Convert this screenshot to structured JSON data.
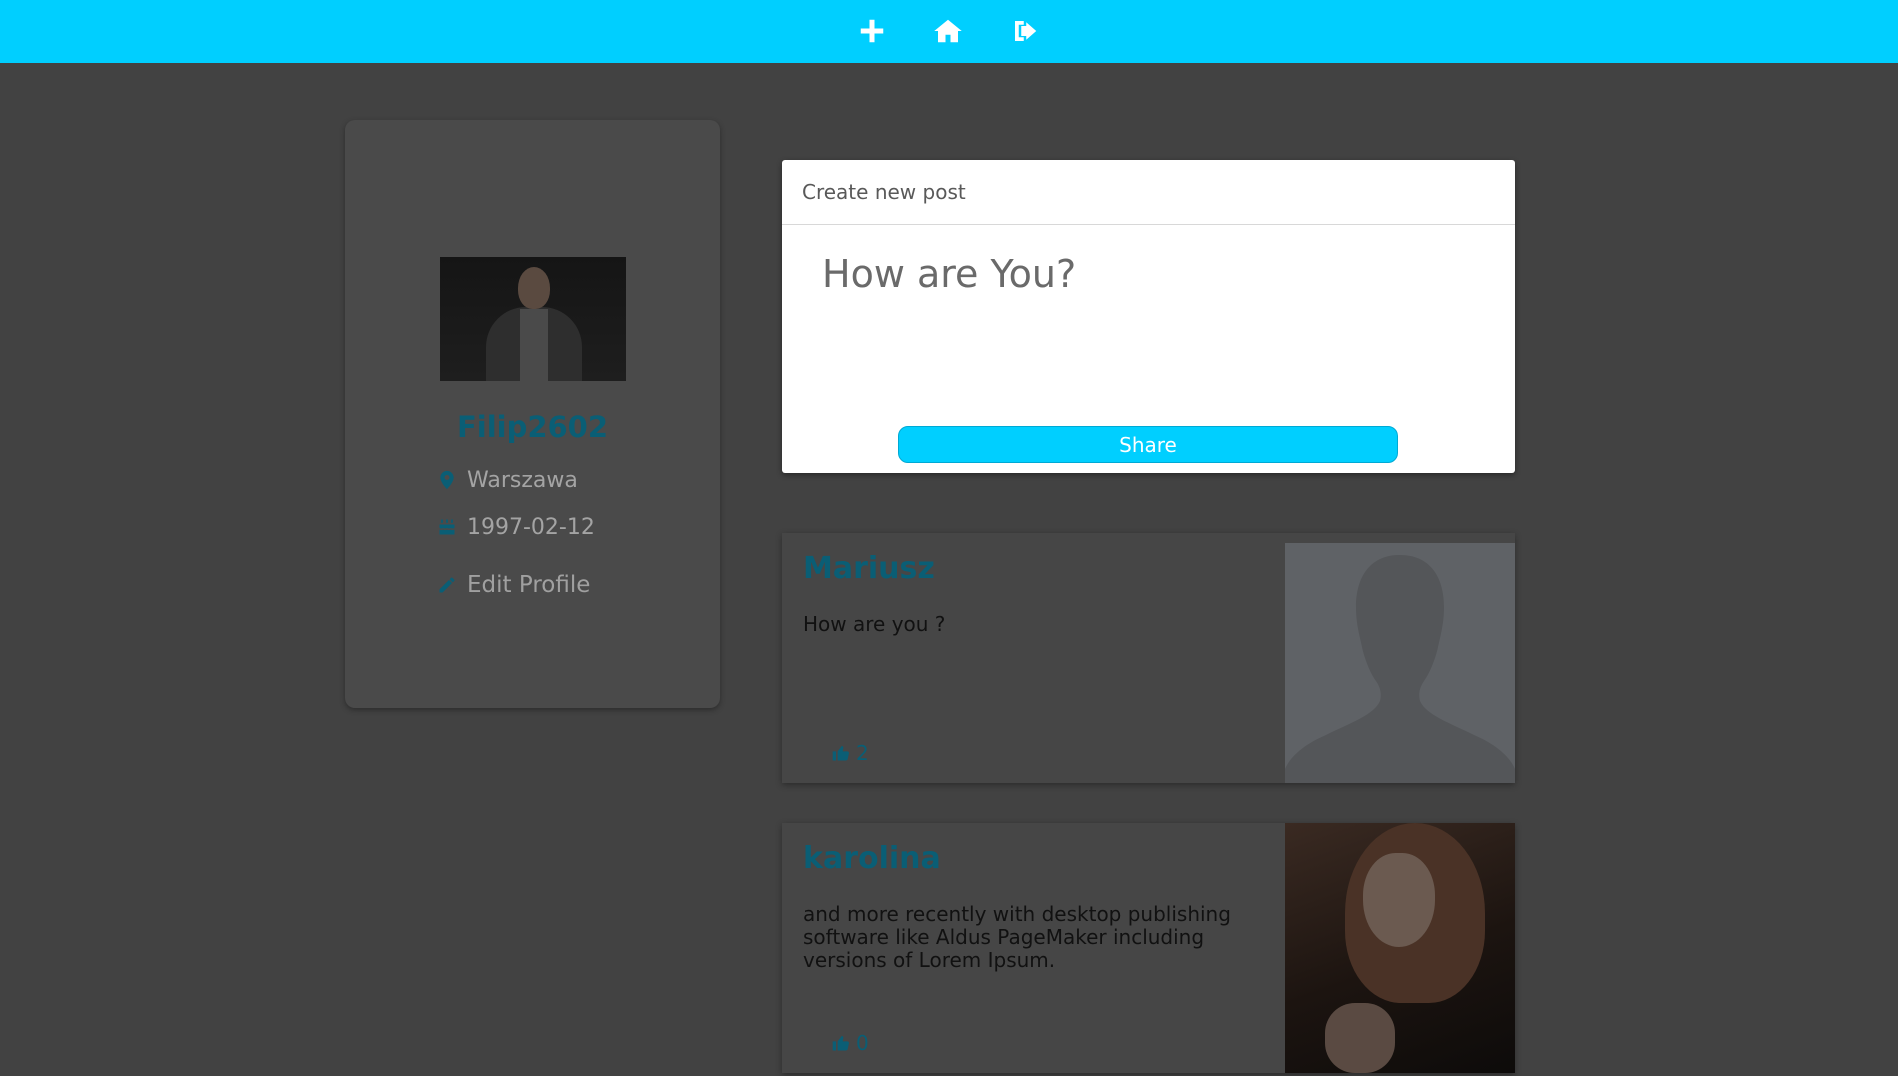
{
  "topbar": {
    "icons": [
      "plus-icon",
      "home-icon",
      "logout-icon"
    ]
  },
  "profile": {
    "username": "Filip2602",
    "location": "Warszawa",
    "birthdate": "1997-02-12",
    "edit_label": "Edit Profile"
  },
  "create_post": {
    "header": "Create new post",
    "placeholder": "How are You?",
    "share_label": "Share"
  },
  "posts": [
    {
      "author": "Mariusz",
      "text": "How are you ?",
      "likes": "2",
      "image": "default-avatar-silhouette"
    },
    {
      "author": "karolina",
      "text": "and more recently with desktop publishing software like Aldus PageMaker including versions of Lorem Ipsum.",
      "likes": "0",
      "image": "user-photo"
    }
  ],
  "colors": {
    "accent": "#00cfff",
    "brand_text": "#0a5e75",
    "background": "#424242"
  }
}
